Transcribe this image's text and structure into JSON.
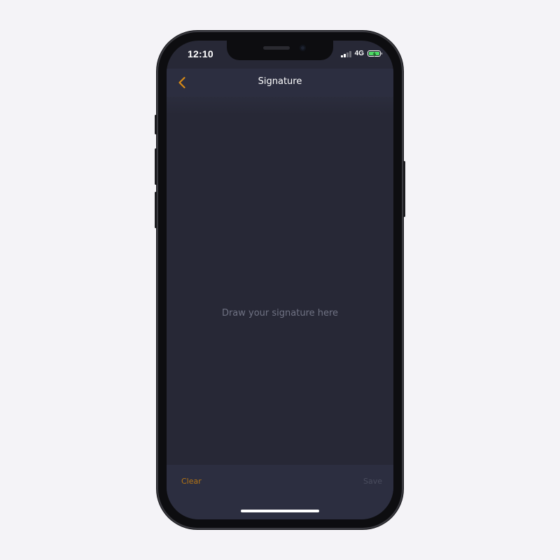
{
  "status_bar": {
    "time": "12:10",
    "network": "4G",
    "battery_icon": "battery-charging-icon",
    "battery_color": "#4cd964"
  },
  "nav": {
    "title": "Signature",
    "back_icon": "chevron-left-icon",
    "accent_color": "#d88a16"
  },
  "canvas": {
    "placeholder": "Draw your signature here"
  },
  "toolbar": {
    "clear_label": "Clear",
    "save_label": "Save",
    "clear_color": "#b67514"
  }
}
